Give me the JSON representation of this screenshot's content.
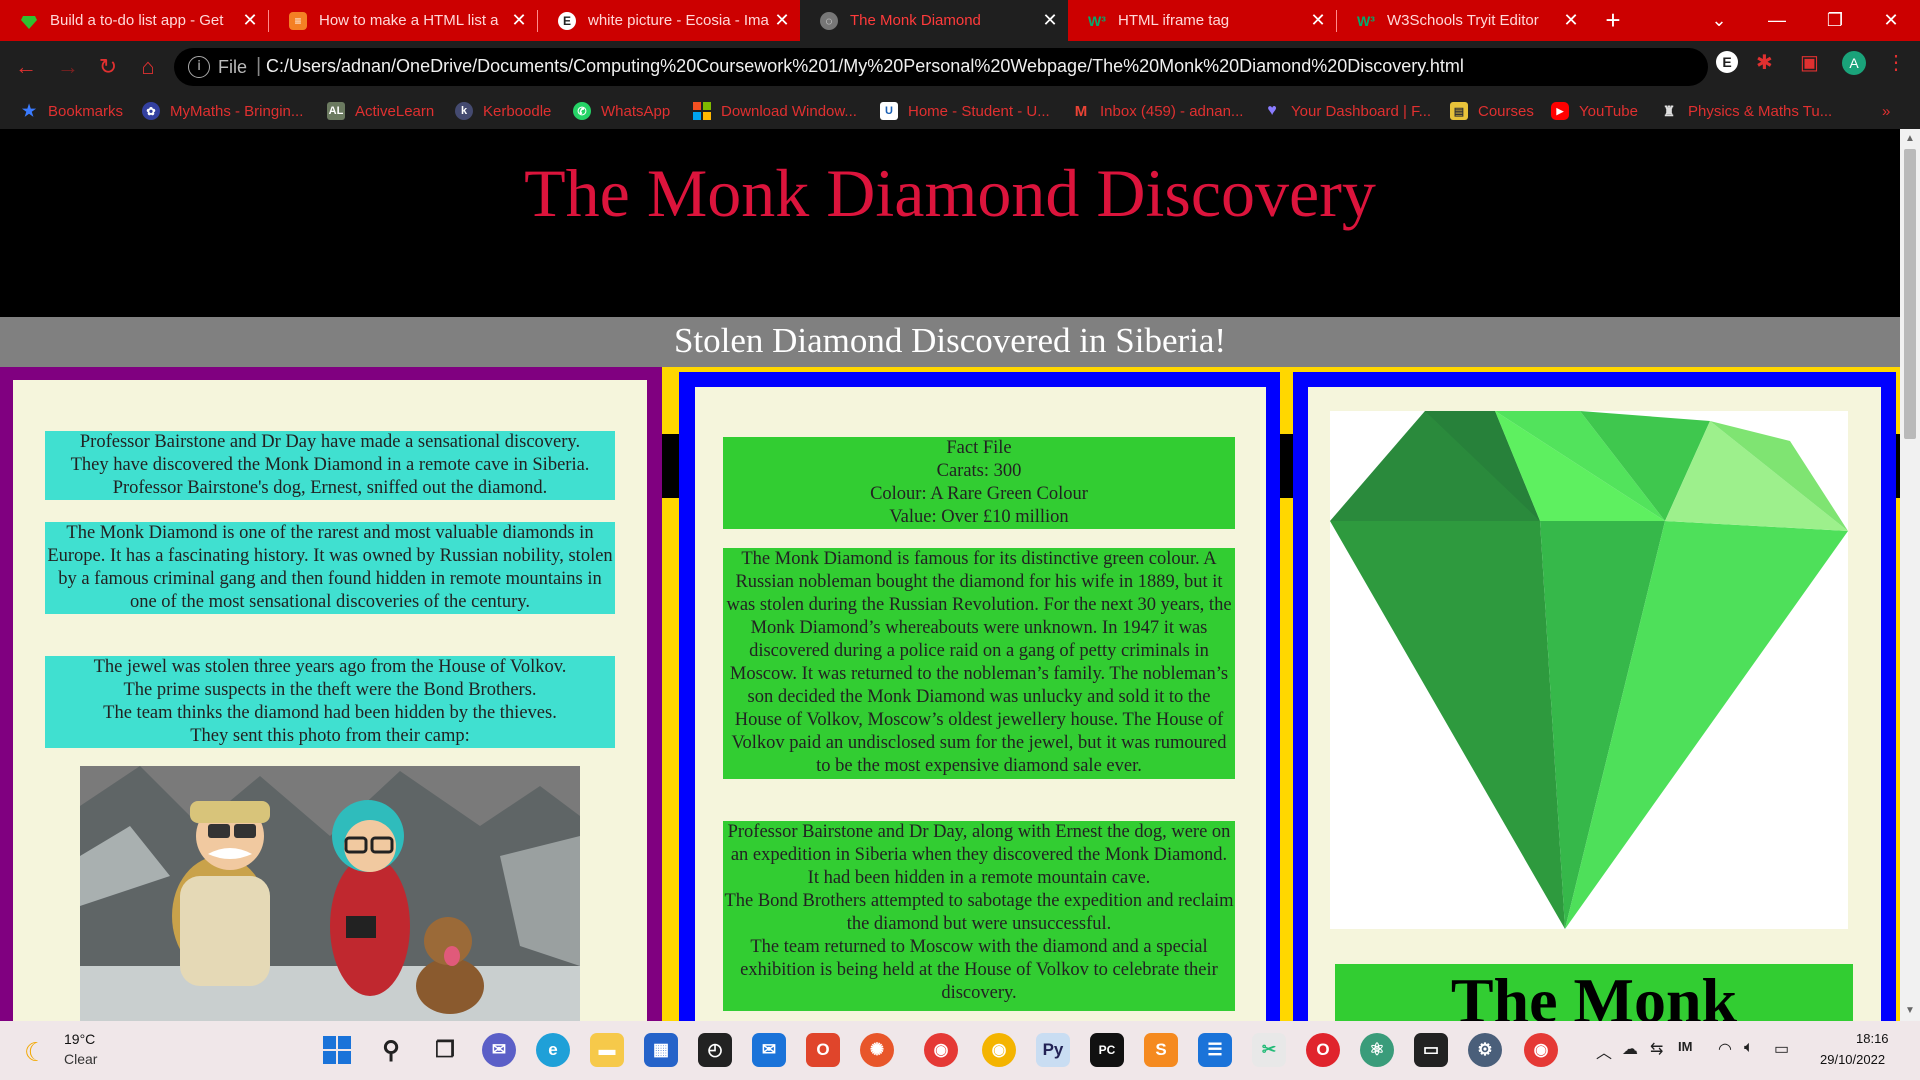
{
  "browser": {
    "tabs": [
      {
        "title": "Build a to-do list app - Get",
        "icon": "gem-icon",
        "color": "#30b030",
        "active": false
      },
      {
        "title": "How to make a HTML list a",
        "icon": "stackoverflow-icon",
        "color": "#f48024",
        "active": false
      },
      {
        "title": "white picture - Ecosia - Ima",
        "icon": "ecosia-icon",
        "color": "#ffffff",
        "active": false
      },
      {
        "title": "The Monk Diamond",
        "icon": "globe-icon",
        "color": "#888888",
        "active": true
      },
      {
        "title": "HTML iframe tag",
        "icon": "w3schools-icon",
        "color": "#04aa6d",
        "active": false
      },
      {
        "title": "W3Schools Tryit Editor",
        "icon": "w3schools-icon",
        "color": "#04aa6d",
        "active": false
      }
    ],
    "address": {
      "scheme_label": "File",
      "url": "C:/Users/adnan/OneDrive/Documents/Computing%20Coursework%201/My%20Personal%20Webpage/The%20Monk%20Diamond%20Discovery.html"
    },
    "profile_initial": "A",
    "bookmarks": [
      {
        "label": "Bookmarks",
        "icon": "star-icon"
      },
      {
        "label": "MyMaths - Bringin...",
        "icon": "mymaths-icon"
      },
      {
        "label": "ActiveLearn",
        "icon": "activelearn-icon",
        "text": "AL"
      },
      {
        "label": "Kerboodle",
        "icon": "kerboodle-icon",
        "text": "k"
      },
      {
        "label": "WhatsApp",
        "icon": "whatsapp-icon"
      },
      {
        "label": "Download Window...",
        "icon": "windows-icon"
      },
      {
        "label": "Home - Student - U...",
        "icon": "unifrog-icon",
        "text": "U"
      },
      {
        "label": "Inbox (459) - adnan...",
        "icon": "gmail-icon",
        "text": "M"
      },
      {
        "label": "Your Dashboard | F...",
        "icon": "heart-icon"
      },
      {
        "label": "Courses",
        "icon": "courses-icon"
      },
      {
        "label": "YouTube",
        "icon": "youtube-icon"
      },
      {
        "label": "Physics & Maths Tu...",
        "icon": "pmt-icon"
      }
    ],
    "bookmarks_overflow": "»"
  },
  "page": {
    "title": "The Monk Diamond Discovery",
    "subtitle": "Stolen Diamond Discovered in Siberia!",
    "colors": {
      "title": "#dc143c",
      "left_border": "#800080",
      "frame_blue": "#0000ff",
      "frame_yellow": "#ffd700",
      "panel": "#f5f5dc",
      "cyan_box": "#40e0d0",
      "green_box": "#32cd32"
    },
    "left_column": {
      "paragraphs": [
        [
          "Professor Bairstone and Dr Day have made a sensational discovery.",
          "They have discovered the Monk Diamond in a remote cave in Siberia.",
          "Professor Bairstone's dog, Ernest, sniffed out the diamond."
        ],
        [
          "The Monk Diamond is one of the rarest and most valuable diamonds in Europe. It has a fascinating history. It was owned by Russian nobility, stolen by a famous criminal gang and then found hidden in remote mountains in one of the most sensational discoveries of the century."
        ],
        [
          "The jewel was stolen three years ago from the House of Volkov.",
          "The prime suspects in the theft were the Bond Brothers.",
          "The team thinks the diamond had been hidden by the thieves.",
          "They sent this photo from their camp:"
        ]
      ]
    },
    "middle_column": {
      "fact_file": [
        "Fact File",
        "Carats: 300",
        "Colour: A Rare Green Colour",
        "Value: Over £10 million"
      ],
      "history": "The Monk Diamond is famous for its distinctive green colour. A Russian nobleman bought the diamond for his wife in 1889, but it was stolen during the Russian Revolution. For the next 30 years, the Monk Diamond’s whereabouts were unknown. In 1947 it was discovered during a police raid on a gang of petty criminals in Moscow. It was returned to the nobleman’s family. The nobleman’s son decided the Monk Diamond was unlucky and sold it to the House of Volkov, Moscow’s oldest jewellery house. The House of Volkov paid an undisclosed sum for the jewel, but it was rumoured to be the most expensive diamond sale ever.",
      "expedition": [
        "Professor Bairstone and Dr Day, along with Ernest the dog, were on an expedition in Siberia when they discovered the Monk Diamond.",
        "It had been hidden in a remote mountain cave.",
        "The Bond Brothers attempted to sabotage the expedition and reclaim the diamond but were unsuccessful.",
        "The team returned to Moscow with the diamond and a special exhibition is being held at the House of Volkov to celebrate their discovery."
      ]
    },
    "right_column": {
      "caption_partial": "The Monk"
    }
  },
  "taskbar": {
    "weather": {
      "temp": "19°C",
      "condition": "Clear"
    },
    "clock": {
      "time": "18:16",
      "date": "29/10/2022"
    }
  }
}
